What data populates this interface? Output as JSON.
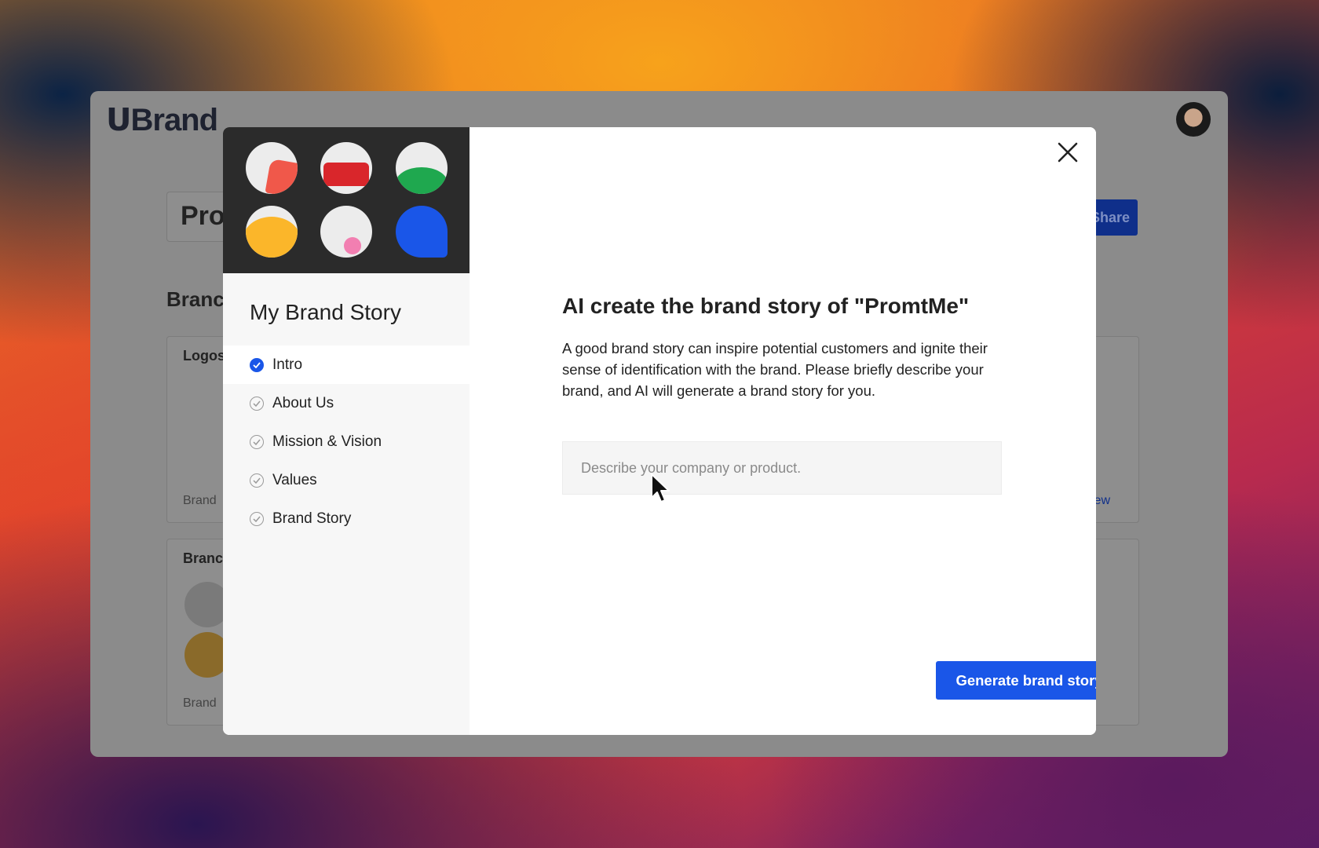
{
  "background_app": {
    "logo": "Brand",
    "title_partial": "Pro",
    "share_label": "Share",
    "section_heading_partial": "Branc",
    "card1_title": "Logos",
    "card1_footer": "Brand",
    "card1_view": "View",
    "card2_title": "Branc",
    "card2_footer": "Brand"
  },
  "modal": {
    "sidebar_title": "My Brand Story",
    "steps": [
      {
        "label": "Intro",
        "active": true
      },
      {
        "label": "About Us",
        "active": false
      },
      {
        "label": "Mission & Vision",
        "active": false
      },
      {
        "label": "Values",
        "active": false
      },
      {
        "label": "Brand Story",
        "active": false
      }
    ],
    "heading": "AI create the brand story of \"PromtMe\"",
    "description": "A good brand story can inspire potential customers and ignite their sense of identification with the brand. Please briefly describe your brand, and AI will generate a brand story for you.",
    "input_placeholder": "Describe your company or product.",
    "input_value": "",
    "generate_label": "Generate brand story",
    "close_icon": "close-icon"
  },
  "colors": {
    "accent": "#1a56e8",
    "illustration_bg": "#2b2b2b",
    "face_red": "#f0584a",
    "face_darkred": "#d9262b",
    "face_green": "#1fa84f",
    "face_yellow": "#fbb62a",
    "face_pink": "#f27fb1",
    "face_blue": "#1a56e8"
  }
}
